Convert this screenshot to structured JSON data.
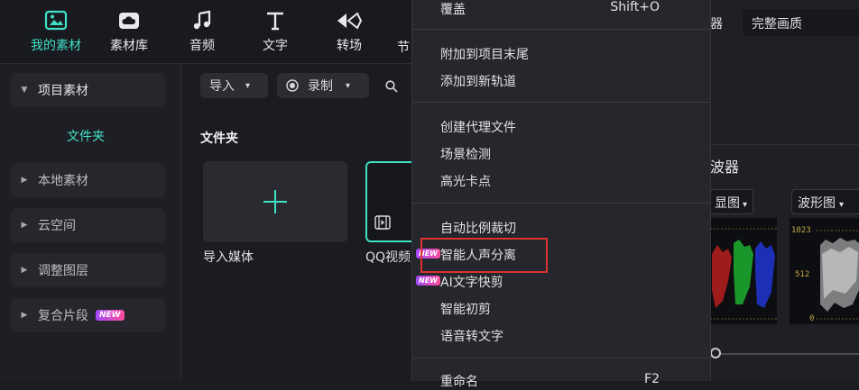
{
  "toolbar": {
    "tabs": [
      {
        "label": "我的素材",
        "icon": "media-folder-icon",
        "active": true
      },
      {
        "label": "素材库",
        "icon": "cloud-library-icon"
      },
      {
        "label": "音频",
        "icon": "music-note-icon"
      },
      {
        "label": "文字",
        "icon": "text-t-icon"
      },
      {
        "label": "转场",
        "icon": "transition-arrows-icon"
      }
    ],
    "partial_tab_glyph": "节"
  },
  "sidebar": {
    "items": [
      {
        "label": "项目素材",
        "expanded": true
      },
      {
        "label": "本地素材"
      },
      {
        "label": "云空间"
      },
      {
        "label": "调整图层"
      },
      {
        "label": "复合片段",
        "badge": "NEW"
      }
    ],
    "sub_folder": "文件夹"
  },
  "media": {
    "import_label": "导入",
    "record_label": "录制",
    "section_title": "文件夹",
    "import_media_label": "导入媒体",
    "qq_video_label": "QQ视频"
  },
  "context_menu": {
    "top": {
      "label": "覆盖",
      "shortcut": "Shift+O"
    },
    "group1": [
      "附加到项目末尾",
      "添加到新轨道"
    ],
    "group2": [
      "创建代理文件",
      "场景检测",
      "高光卡点"
    ],
    "group3": [
      {
        "label": "自动比例裁切"
      },
      {
        "label": "智能人声分离",
        "badge": "NEW"
      },
      {
        "label": "AI文字快剪",
        "badge": "NEW"
      },
      {
        "label": "智能初剪"
      },
      {
        "label": "语音转文字"
      }
    ],
    "bottom": {
      "label": "重命名",
      "shortcut": "F2"
    }
  },
  "right_panel": {
    "header_partial": "器",
    "quality": "完整画质",
    "scope_title_partial": "波器",
    "scope_left_dropdown": "显图",
    "scope_right_dropdown": "波形图",
    "waveform_ticks": [
      "1023",
      "512",
      "0"
    ]
  },
  "colors": {
    "accent": "#3fe0c6",
    "highlight_box": "#e03030"
  }
}
